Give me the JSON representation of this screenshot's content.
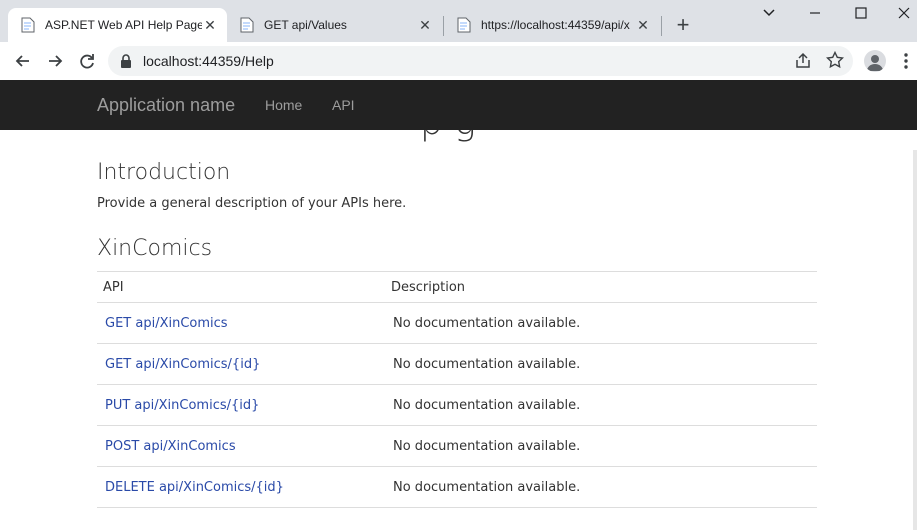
{
  "browser": {
    "tabs": [
      {
        "title": "ASP.NET Web API Help Page",
        "active": true
      },
      {
        "title": "GET api/Values",
        "active": false
      },
      {
        "title": "https://localhost:44359/api/x",
        "active": false
      }
    ],
    "new_tab_symbol": "+",
    "url": "localhost:44359/Help"
  },
  "navbar": {
    "brand": "Application name",
    "links": [
      "Home",
      "API"
    ]
  },
  "page": {
    "hidden_title_fragment": "p g",
    "intro_heading": "Introduction",
    "intro_text": "Provide a general description of your APIs here.",
    "section_heading": "XinComics",
    "table": {
      "headers": [
        "API",
        "Description"
      ],
      "rows": [
        {
          "api": "GET api/XinComics",
          "description": "No documentation available."
        },
        {
          "api": "GET api/XinComics/{id}",
          "description": "No documentation available."
        },
        {
          "api": "PUT api/XinComics/{id}",
          "description": "No documentation available."
        },
        {
          "api": "POST api/XinComics",
          "description": "No documentation available."
        },
        {
          "api": "DELETE api/XinComics/{id}",
          "description": "No documentation available."
        }
      ]
    }
  },
  "colors": {
    "navbar_bg": "#222222",
    "navbar_text": "#9d9d9d",
    "link": "#2a4aa8",
    "tabstrip_bg": "#dee1e6"
  },
  "icons": {
    "tab_favicon": "document-icon",
    "back": "back-arrow-icon",
    "forward": "forward-arrow-icon",
    "reload": "reload-icon",
    "lock": "lock-icon",
    "share": "share-icon",
    "bookmark": "star-icon",
    "profile": "profile-icon",
    "menu": "kebab-menu-icon"
  }
}
